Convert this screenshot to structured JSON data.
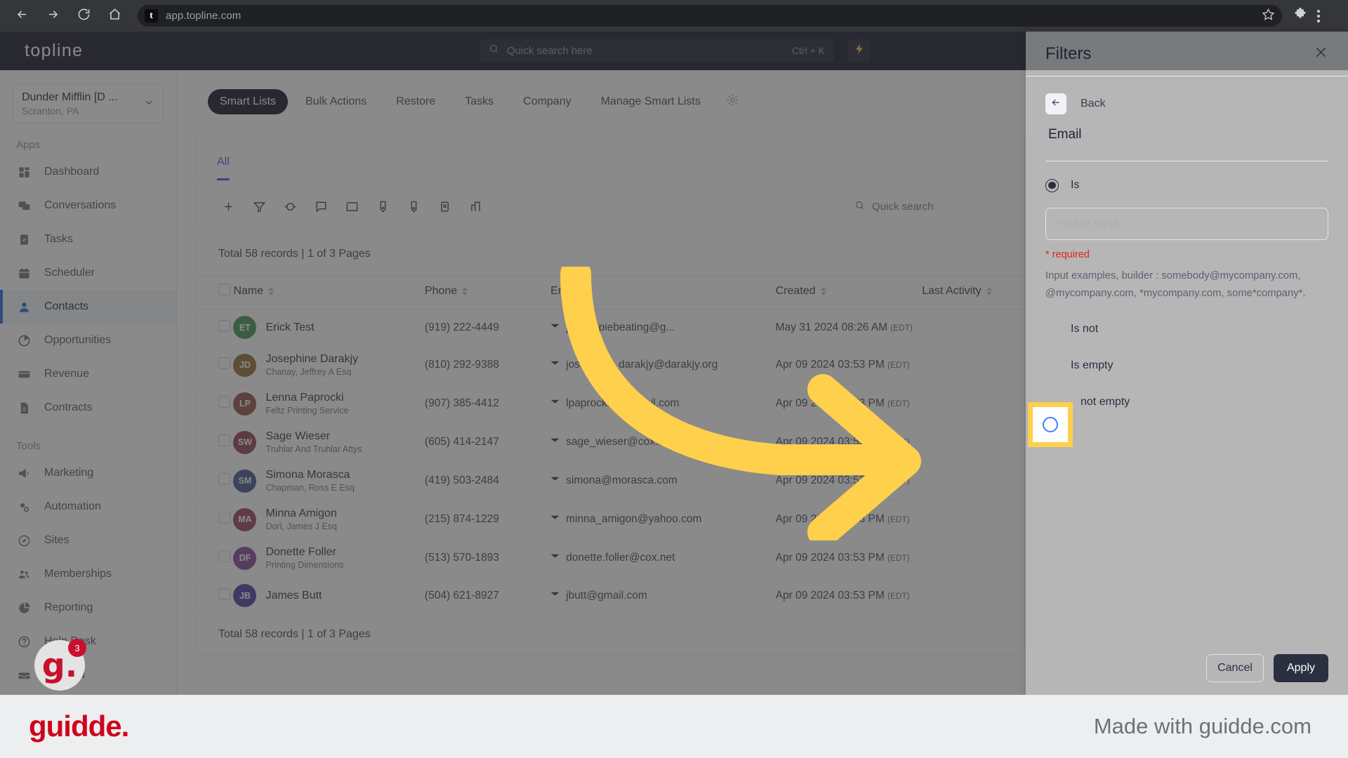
{
  "browser": {
    "url": "app.topline.com",
    "site_initial": "t",
    "icons": {
      "back": "back-arrow-icon",
      "forward": "forward-arrow-icon",
      "reload": "reload-icon",
      "home": "home-icon",
      "bookmark": "star-icon",
      "extensions": "puzzle-icon",
      "menu": "kebab-menu-icon"
    }
  },
  "topbar": {
    "brand": "topline",
    "search_placeholder": "Quick search here",
    "search_shortcut": "Ctrl + K",
    "bolt_label": "quick-actions"
  },
  "sidebar": {
    "org_name": "Dunder Mifflin [D ...",
    "org_location": "Scranton, PA",
    "sections": [
      {
        "label": "Apps",
        "items": [
          {
            "label": "Dashboard",
            "icon": "dashboard-icon",
            "active": false
          },
          {
            "label": "Conversations",
            "icon": "conversations-icon",
            "active": false
          },
          {
            "label": "Tasks",
            "icon": "tasks-icon",
            "active": false
          },
          {
            "label": "Scheduler",
            "icon": "calendar-icon",
            "active": false
          },
          {
            "label": "Contacts",
            "icon": "contacts-icon",
            "active": true
          },
          {
            "label": "Opportunities",
            "icon": "opportunities-icon",
            "active": false
          },
          {
            "label": "Revenue",
            "icon": "revenue-icon",
            "active": false
          },
          {
            "label": "Contracts",
            "icon": "contracts-icon",
            "active": false
          }
        ]
      },
      {
        "label": "Tools",
        "items": [
          {
            "label": "Marketing",
            "icon": "megaphone-icon",
            "active": false
          },
          {
            "label": "Automation",
            "icon": "gears-icon",
            "active": false
          },
          {
            "label": "Sites",
            "icon": "sites-icon",
            "active": false
          },
          {
            "label": "Memberships",
            "icon": "memberships-icon",
            "active": false
          },
          {
            "label": "Reporting",
            "icon": "pie-chart-icon",
            "active": false
          },
          {
            "label": "Help Desk",
            "icon": "help-icon",
            "active": false
          },
          {
            "label": "Inbound",
            "icon": "inbound-icon",
            "active": false
          }
        ]
      }
    ]
  },
  "main": {
    "tabs": [
      {
        "label": "Smart Lists",
        "selected": true
      },
      {
        "label": "Bulk Actions",
        "selected": false
      },
      {
        "label": "Restore",
        "selected": false
      },
      {
        "label": "Tasks",
        "selected": false
      },
      {
        "label": "Company",
        "selected": false
      },
      {
        "label": "Manage Smart Lists",
        "selected": false
      }
    ],
    "settings_icon": "gear-icon",
    "sub_tab": "All",
    "toolbar_icons": [
      "add-contact-icon",
      "filter-icon",
      "import-icon",
      "sms-icon",
      "email-icon",
      "add-tag-icon",
      "remove-tag-icon",
      "export-icon",
      "merge-icon"
    ],
    "quick_search_placeholder": "Quick search",
    "records_summary": "Total 58 records | 1 of 3 Pages",
    "columns": [
      "Name",
      "Phone",
      "Email",
      "Created",
      "Last Activity"
    ],
    "rows": [
      {
        "initials": "ET",
        "color": "#3f8f4b",
        "name": "Erick Test",
        "company": "",
        "phone": "(919) 222-4449",
        "email": "jabronipiebeating@g...",
        "created": "May 31 2024 08:26 AM",
        "tz": "(EDT)",
        "last_activity": ""
      },
      {
        "initials": "JD",
        "color": "#8a6a28",
        "name": "Josephine Darakjy",
        "company": "Chanay, Jeffrey A Esq",
        "phone": "(810) 292-9388",
        "email": "josephine_darakjy@darakjy.org",
        "created": "Apr 09 2024 03:53 PM",
        "tz": "(EDT)",
        "last_activity": ""
      },
      {
        "initials": "LP",
        "color": "#8c4a3f",
        "name": "Lenna Paprocki",
        "company": "Feltz Printing Service",
        "phone": "(907) 385-4412",
        "email": "lpaprocki@hotmail.com",
        "created": "Apr 09 2024 03:53 PM",
        "tz": "(EDT)",
        "last_activity": ""
      },
      {
        "initials": "SW",
        "color": "#8e3a4e",
        "name": "Sage Wieser",
        "company": "Truhlar And Truhlar Attys",
        "phone": "(605) 414-2147",
        "email": "sage_wieser@cox.net",
        "created": "Apr 09 2024 03:53 PM",
        "tz": "(EDT)",
        "last_activity": ""
      },
      {
        "initials": "SM",
        "color": "#3a4f8e",
        "name": "Simona Morasca",
        "company": "Chapman, Ross E Esq",
        "phone": "(419) 503-2484",
        "email": "simona@morasca.com",
        "created": "Apr 09 2024 03:53 PM",
        "tz": "(EDT)",
        "last_activity": ""
      },
      {
        "initials": "MA",
        "color": "#97375e",
        "name": "Minna Amigon",
        "company": "Dorl, James J Esq",
        "phone": "(215) 874-1229",
        "email": "minna_amigon@yahoo.com",
        "created": "Apr 09 2024 03:53 PM",
        "tz": "(EDT)",
        "last_activity": ""
      },
      {
        "initials": "DF",
        "color": "#7d3f96",
        "name": "Donette Foller",
        "company": "Printing Dimensions",
        "phone": "(513) 570-1893",
        "email": "donette.foller@cox.net",
        "created": "Apr 09 2024 03:53 PM",
        "tz": "(EDT)",
        "last_activity": ""
      },
      {
        "initials": "JB",
        "color": "#4339a1",
        "name": "James Butt",
        "company": "",
        "phone": "(504) 621-8927",
        "email": "jbutt@gmail.com",
        "created": "Apr 09 2024 03:53 PM",
        "tz": "(EDT)",
        "last_activity": ""
      }
    ],
    "footer_records": "Total 58 records | 1 of 3 Pages"
  },
  "filters": {
    "title": "Filters",
    "close_icon": "close-icon",
    "back_label": "Back",
    "back_icon": "back-arrow-icon",
    "field_name": "Email",
    "options": [
      {
        "label": "Is",
        "selected": true
      },
      {
        "label": "Is not",
        "selected": false
      },
      {
        "label": "Is empty",
        "selected": false
      },
      {
        "label": "not empty",
        "selected": false,
        "highlighted": true
      }
    ],
    "input_placeholder": "Please Input",
    "required_text": "* required",
    "hint_text": "Input examples, builder : somebody@mycompany.com, @mycompany.com, *mycompany.com, some*company*.",
    "cancel_label": "Cancel",
    "apply_label": "Apply"
  },
  "overlay": {
    "highlight_color": "#FFD04C",
    "arrow_color": "#FFD04C",
    "guidde_badge_count": "3",
    "guidde_mark": "g."
  },
  "footer": {
    "logo": "guidde.",
    "made_with": "Made with guidde.com"
  }
}
